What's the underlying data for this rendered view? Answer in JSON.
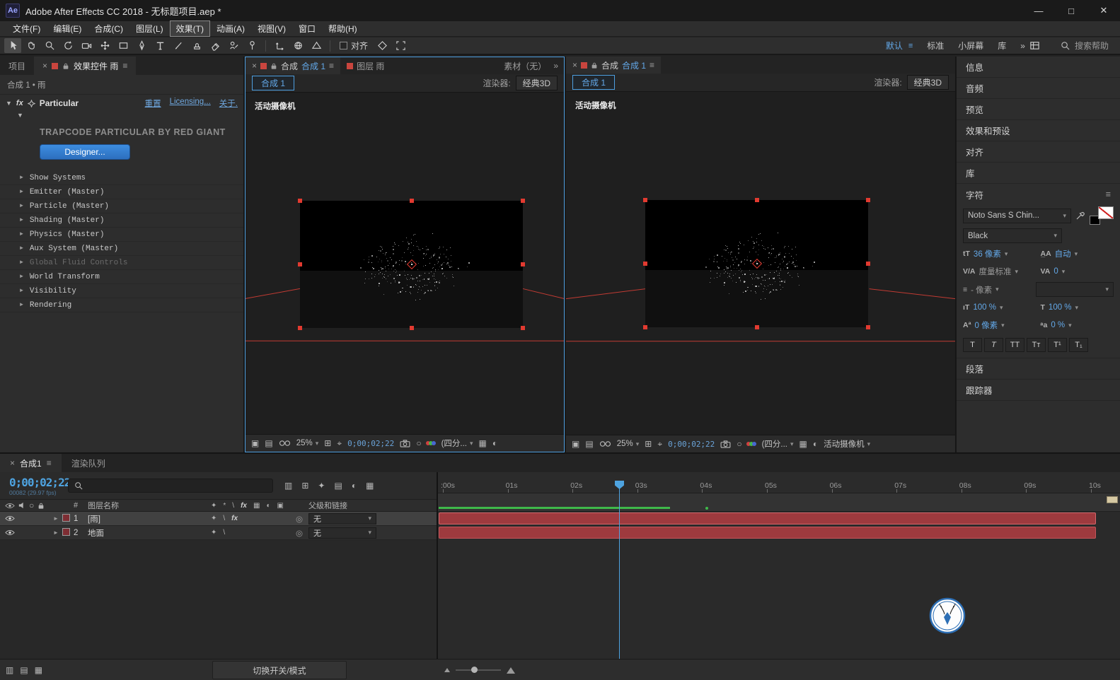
{
  "titlebar": {
    "app_icon": "Ae",
    "title": "Adobe After Effects CC 2018 - 无标题项目.aep *",
    "minimize": "—",
    "maximize": "□",
    "close": "✕"
  },
  "menu": {
    "items": [
      "文件(F)",
      "编辑(E)",
      "合成(C)",
      "图层(L)",
      "效果(T)",
      "动画(A)",
      "视图(V)",
      "窗口",
      "帮助(H)"
    ],
    "active": "效果(T)"
  },
  "toolbar": {
    "align_label": "对齐",
    "workspaces": [
      "默认",
      "标准",
      "小屏幕",
      "库"
    ],
    "active_workspace": "默认",
    "overflow": "»",
    "search_placeholder": "搜索帮助"
  },
  "effects_panel": {
    "tab_project": "项目",
    "tab_title": "效果控件 雨",
    "breadcrumb": "合成 1 • 雨",
    "fx_badge": "fx",
    "effect_label": "Particular",
    "links": {
      "reset": "重置",
      "licensing": "Licensing...",
      "about": "关于."
    },
    "brand": "TRAPCODE PARTICULAR BY RED GIANT",
    "designer_button": "Designer...",
    "groups": [
      {
        "label": "Show Systems",
        "dim": false
      },
      {
        "label": "Emitter (Master)",
        "dim": false
      },
      {
        "label": "Particle (Master)",
        "dim": false
      },
      {
        "label": "Shading (Master)",
        "dim": false
      },
      {
        "label": "Physics (Master)",
        "dim": false
      },
      {
        "label": "Aux System (Master)",
        "dim": false
      },
      {
        "label": "Global Fluid Controls",
        "dim": true
      },
      {
        "label": "World Transform",
        "dim": false
      },
      {
        "label": "Visibility",
        "dim": false
      },
      {
        "label": "Rendering",
        "dim": false
      }
    ]
  },
  "viewer_left": {
    "comp_tab_prefix": "合成",
    "comp_tab_name": "合成 1",
    "layer_tab": "图层 雨",
    "footage_tab": "素材（无）",
    "breadcrumb": "合成 1",
    "renderer_label": "渲染器:",
    "renderer_value": "经典3D",
    "camera_label": "活动摄像机",
    "zoom": "25%",
    "timecode": "0;00;02;22",
    "view_layout": "(四分..."
  },
  "viewer_right": {
    "comp_tab_prefix": "合成",
    "comp_tab_name": "合成 1",
    "breadcrumb": "合成 1",
    "renderer_label": "渲染器:",
    "renderer_value": "经典3D",
    "camera_label": "活动摄像机",
    "zoom": "25%",
    "timecode": "0;00;02;22",
    "view_layout": "(四分...",
    "camera_select": "活动摄像机"
  },
  "sidebar": {
    "panels_top": [
      "信息",
      "音频",
      "预览",
      "效果和预设",
      "对齐",
      "库"
    ],
    "character": {
      "title": "字符",
      "font_family": "Noto Sans S Chin...",
      "font_style": "Black",
      "font_size": "36 像素",
      "leading": "自动",
      "kerning": "度量标准",
      "tracking": "0",
      "tsume": "- 像素",
      "vertical_scale": "100 %",
      "horizontal_scale": "100 %",
      "baseline_shift": "0 像素",
      "proportional_spacing": "0 %",
      "buttons": [
        "T",
        "T",
        "TT",
        "Tᴛ",
        "T¹",
        "T₁"
      ]
    },
    "panels_bottom": [
      "段落",
      "跟踪器"
    ]
  },
  "timeline": {
    "tab_comp": "合成1",
    "tab_render_queue": "渲染队列",
    "timecode": "0;00;02;22",
    "frame_info": "00082 (29.97 fps)",
    "ruler_ticks": [
      ":00s",
      "01s",
      "02s",
      "03s",
      "04s",
      "05s",
      "06s",
      "07s",
      "08s",
      "09s",
      "10s"
    ],
    "columns": {
      "hash": "#",
      "layer_name": "图层名称",
      "parent": "父级和链接"
    },
    "layers": [
      {
        "num": "1",
        "name": "[雨]",
        "parent": "无"
      },
      {
        "num": "2",
        "name": "地面",
        "parent": "无"
      }
    ],
    "toggle_modes": "切换开关/模式"
  },
  "icons": {
    "close": "×",
    "menu": "≡",
    "caret": "▾",
    "tri_right": "►",
    "tri_down": "▼",
    "pickwhip": "◎",
    "grid": "⊞",
    "target": "⌖",
    "circle": "○",
    "pixel_aspect": "▤",
    "exposure": "◐",
    "preview": "▣",
    "mosaic": "▦",
    "star": "*",
    "slash": "\\",
    "shy": "✦",
    "flowchart": "▥"
  }
}
